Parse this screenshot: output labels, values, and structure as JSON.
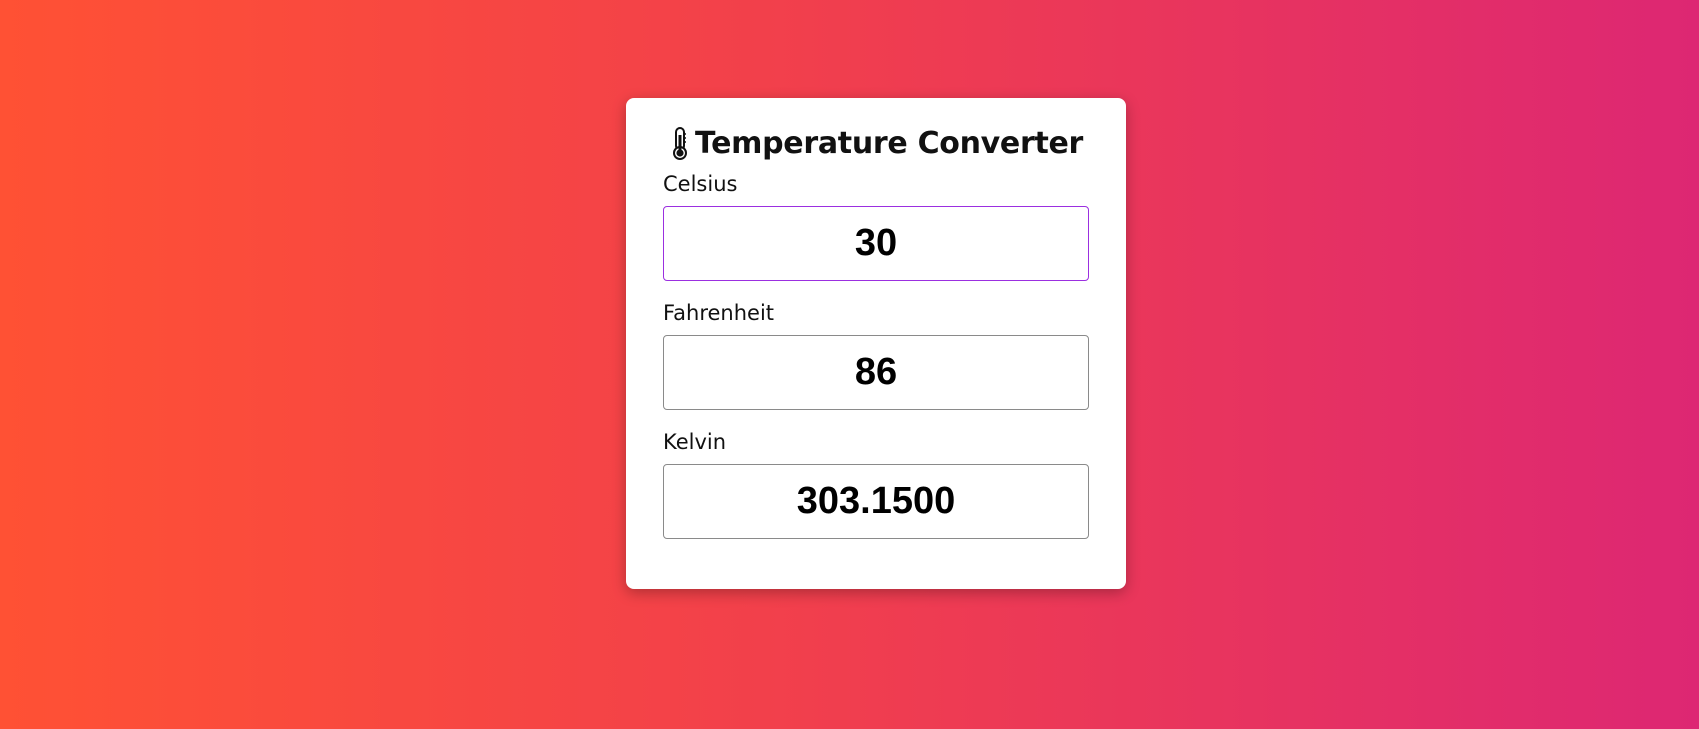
{
  "app": {
    "title": "Temperature Converter",
    "icon": "thermometer-icon"
  },
  "fields": {
    "celsius": {
      "label": "Celsius",
      "value": "30"
    },
    "fahrenheit": {
      "label": "Fahrenheit",
      "value": "86"
    },
    "kelvin": {
      "label": "Kelvin",
      "value": "303.1500"
    }
  },
  "colors": {
    "background_start": "#ff5134",
    "background_end": "#dd2773",
    "focus_border": "#9b2fe0",
    "card": "#ffffff"
  }
}
